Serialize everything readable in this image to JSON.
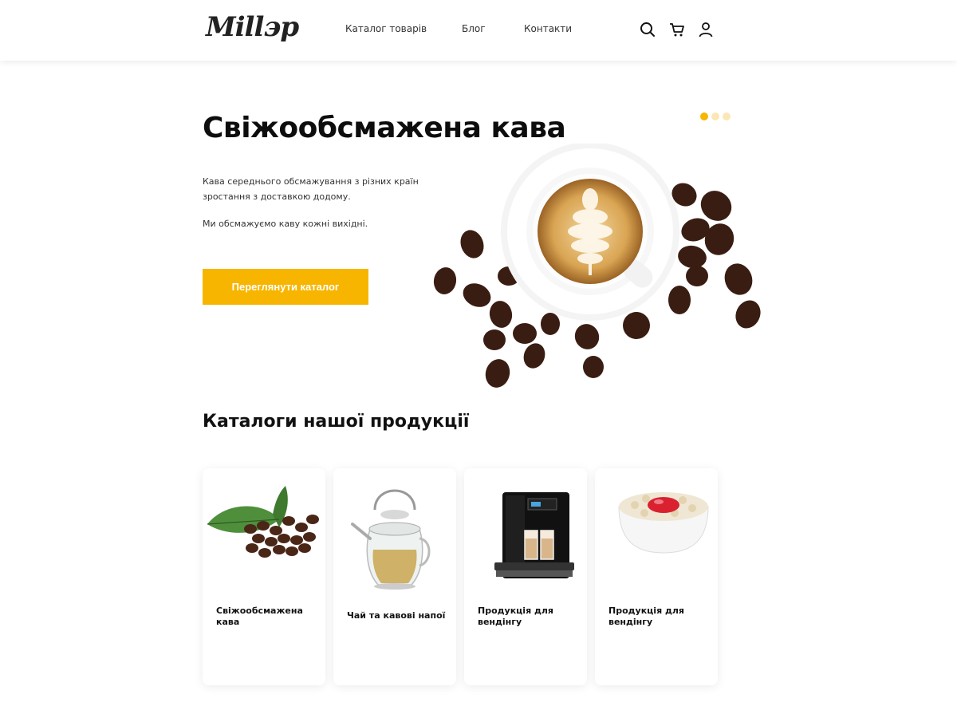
{
  "header": {
    "logo_text": "Millэр",
    "nav": [
      {
        "label": "Каталог товарів"
      },
      {
        "label": "Блог"
      },
      {
        "label": "Контакти"
      }
    ],
    "icons": [
      "search-icon",
      "cart-icon",
      "user-icon"
    ]
  },
  "hero": {
    "title": "Свіжообсмажена кава",
    "description": "Кава середнього обсмажування з різних країн зростання з доставкою додому.",
    "description2": "Ми обсмажуємо каву кожні вихідні.",
    "button_label": "Переглянути каталог",
    "slider": {
      "count": 3,
      "active": 1
    }
  },
  "catalog": {
    "title": "Каталоги нашої продукції",
    "cards": [
      {
        "title": "Свіжообсмажена кава"
      },
      {
        "title": "Чай та кавові напої"
      },
      {
        "title": "Продукція для вендінгу"
      },
      {
        "title": "Продукція для вендінгу"
      }
    ]
  },
  "colors": {
    "accent": "#f7b500",
    "text": "#111111",
    "background": "#ffffff"
  }
}
